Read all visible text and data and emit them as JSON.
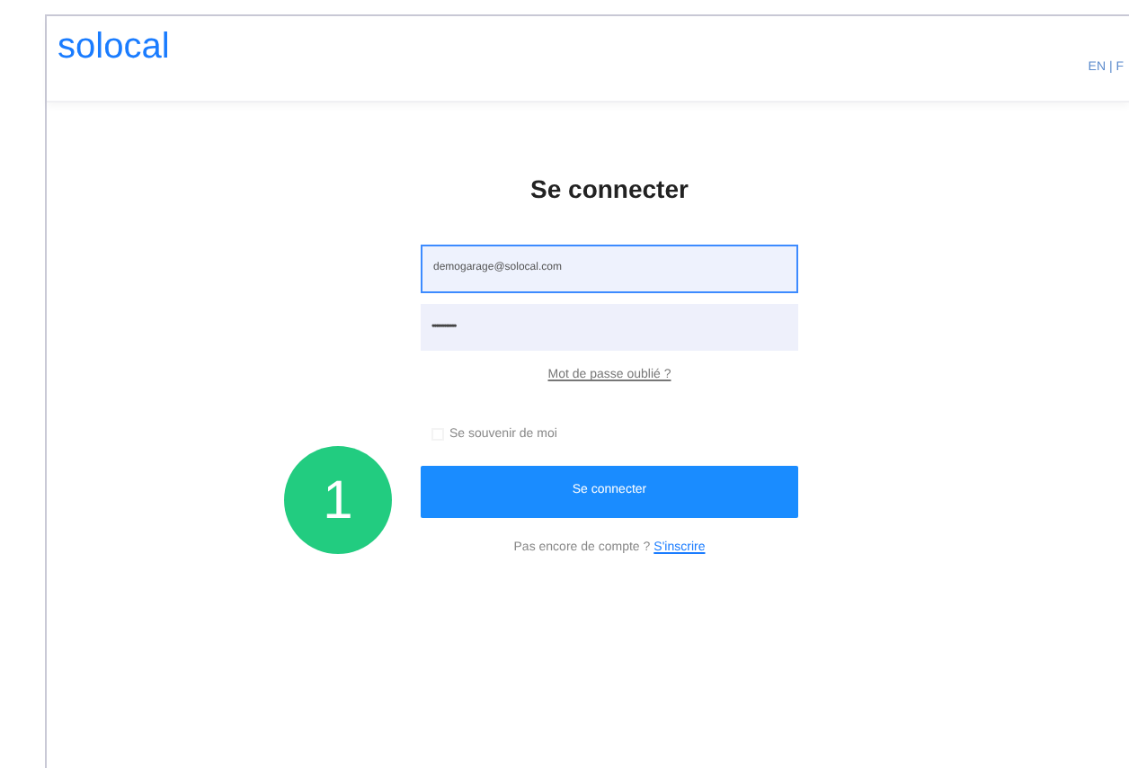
{
  "header": {
    "logo": "solocal",
    "language_switch": "EN | F"
  },
  "login": {
    "title": "Se connecter",
    "email": {
      "value": "demogarage@solocal.com"
    },
    "password": {
      "value": "••••••••••••"
    },
    "forgot_link": "Mot de passe oublié ?",
    "remember_me": {
      "label": "Se souvenir de moi",
      "checked": false
    },
    "submit": "Se connecter",
    "signup_prompt": "Pas encore de compte ?",
    "signup_link": "S'inscrire"
  },
  "step_badge": "1"
}
